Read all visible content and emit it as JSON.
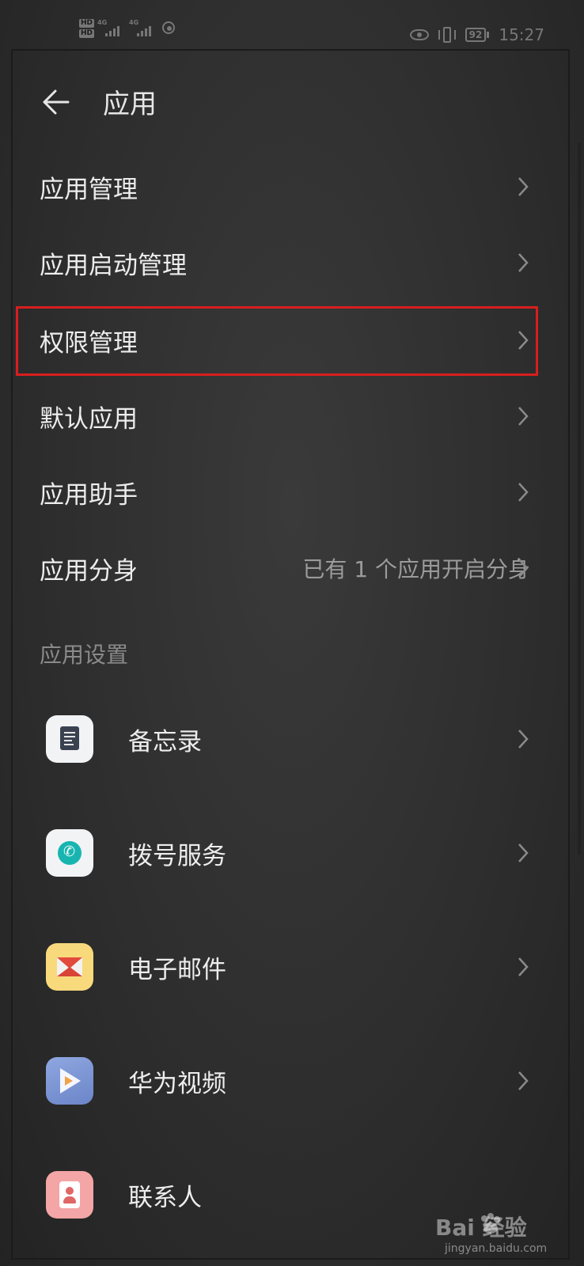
{
  "status_bar": {
    "hd_top": "HD",
    "hd_bottom": "HD",
    "network1": "4G",
    "network2": "4G",
    "battery": "92",
    "time": "15:27"
  },
  "header": {
    "title": "应用"
  },
  "menu": [
    {
      "label": "应用管理",
      "value": ""
    },
    {
      "label": "应用启动管理",
      "value": ""
    },
    {
      "label": "权限管理",
      "value": "",
      "highlighted": true
    },
    {
      "label": "默认应用",
      "value": ""
    },
    {
      "label": "应用助手",
      "value": ""
    },
    {
      "label": "应用分身",
      "value": "已有 1 个应用开启分身"
    }
  ],
  "section": {
    "title": "应用设置"
  },
  "apps": [
    {
      "label": "备忘录",
      "icon": "notes-icon"
    },
    {
      "label": "拨号服务",
      "icon": "dialer-icon"
    },
    {
      "label": "电子邮件",
      "icon": "mail-icon"
    },
    {
      "label": "华为视频",
      "icon": "video-icon"
    },
    {
      "label": "联系人",
      "icon": "contacts-icon"
    }
  ],
  "watermark": {
    "logo": "Bai  经验",
    "sub": "jingyan.baidu.com"
  },
  "colors": {
    "highlight": "#d81e1e",
    "background": "#2b2b2b"
  }
}
